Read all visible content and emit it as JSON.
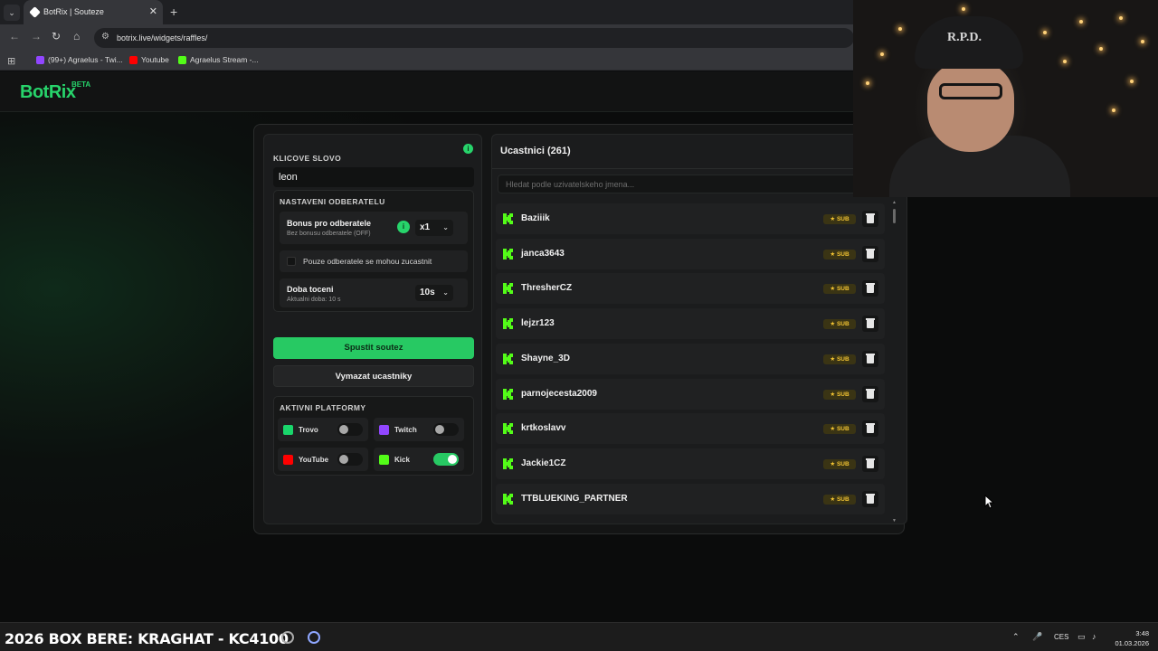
{
  "browser": {
    "tab_title": "BotRix | Souteze",
    "tab_close": "✕",
    "new_tab": "+",
    "tab_dropdown": "⌄",
    "url": "botrix.live/widgets/raffles/",
    "bookmarks": [
      {
        "label": "(99+) Agraelus - Twi...",
        "color": "#9146ff"
      },
      {
        "label": "Youtube",
        "color": "#ff0000"
      },
      {
        "label": "Agraelus Stream -...",
        "color": "#53fc18"
      }
    ]
  },
  "header": {
    "logo": "BotRix",
    "badge": "BETA"
  },
  "settings": {
    "keyword_label": "KLICOVE SLOVO",
    "keyword_value": "leon",
    "subscriber_section_label": "NASTAVENI ODBERATELU",
    "bonus_title": "Bonus pro odberatele",
    "bonus_sub": "Bez bonusu odberatele (OFF)",
    "bonus_select": "x1",
    "only_subs_label": "Pouze odberatele se mohou zucastnit",
    "spin_title": "Doba toceni",
    "spin_sub": "Aktualni doba: 10 s",
    "spin_select": "10s",
    "start_button": "Spustit soutez",
    "clear_button": "Vymazat ucastniky",
    "platforms_label": "AKTIVNI PLATFORMY",
    "platforms": [
      {
        "name": "Trovo",
        "enabled": false,
        "color": "#19d66b"
      },
      {
        "name": "Twitch",
        "enabled": false,
        "color": "#9146ff"
      },
      {
        "name": "YouTube",
        "enabled": false,
        "color": "#ff0000"
      },
      {
        "name": "Kick",
        "enabled": true,
        "color": "#53fc18"
      }
    ]
  },
  "participants": {
    "title": "Ucastnici (261)",
    "search_placeholder": "Hledat podle uzivatelskeho jmena...",
    "badge_label": "★ SUB",
    "items": [
      "Baziiik",
      "janca3643",
      "ThresherCZ",
      "lejzr123",
      "Shayne_3D",
      "parnojecesta2009",
      "krtkoslavv",
      "Jackie1CZ",
      "TTBLUEKING_PARTNER"
    ]
  },
  "webcam": {
    "cap_text": "R.P.D."
  },
  "taskbar": {
    "ticker": "2026 BOX BERE: KRAGHAT - KC4100",
    "language": "CES",
    "time": "3:48",
    "date": "01.03.2026"
  },
  "colors": {
    "accent": "#27d46b",
    "sub_badge": "#f3c432"
  }
}
